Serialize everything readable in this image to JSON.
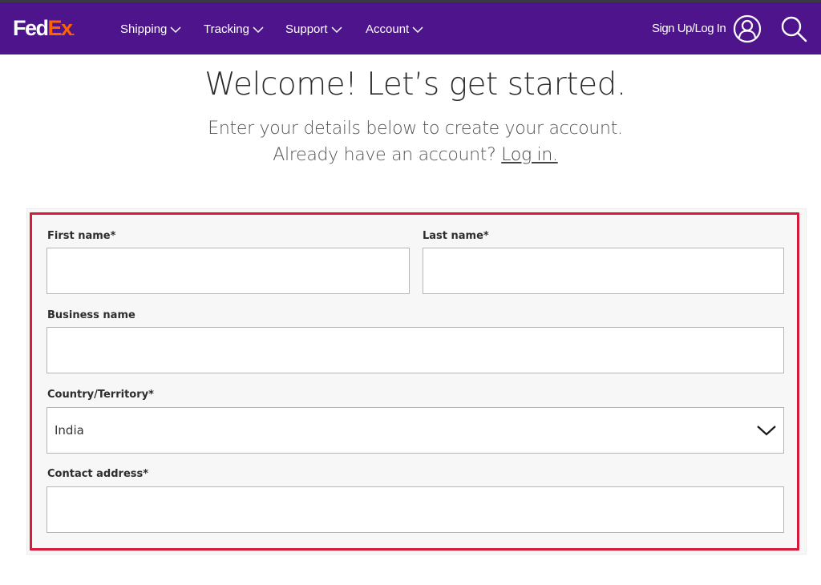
{
  "header": {
    "logo": {
      "part1": "Fed",
      "part2": "Ex",
      "dot": "."
    },
    "nav": [
      {
        "label": "Shipping",
        "icon": "chevron-down-icon"
      },
      {
        "label": "Tracking",
        "icon": "chevron-down-icon"
      },
      {
        "label": "Support",
        "icon": "chevron-down-icon"
      },
      {
        "label": "Account",
        "icon": "chevron-down-icon"
      }
    ],
    "sign_in_label": "Sign Up/Log In",
    "user_icon": "user-circle-icon",
    "search_icon": "search-icon"
  },
  "colors": {
    "brand_purple": "#4d148c",
    "brand_orange": "#ff6200",
    "highlight_red": "#d7193c"
  },
  "intro": {
    "title": "Welcome! Let’s get started.",
    "subtitle": "Enter your details below to create your account.",
    "login_prompt": "Already have an account?",
    "login_link": "Log in."
  },
  "form": {
    "first_name": {
      "label": "First name*",
      "value": ""
    },
    "last_name": {
      "label": "Last name*",
      "value": ""
    },
    "business_name": {
      "label": "Business name",
      "value": ""
    },
    "country": {
      "label": "Country/Territory*",
      "value": "India"
    },
    "contact_address": {
      "label": "Contact address*",
      "value": ""
    }
  }
}
